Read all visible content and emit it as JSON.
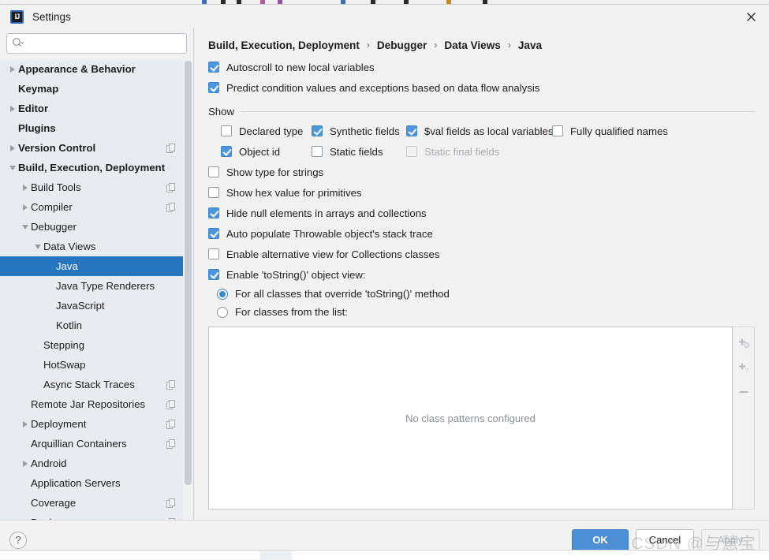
{
  "window": {
    "title": "Settings",
    "logo_text": "IJ",
    "close_icon": "close-icon"
  },
  "search": {
    "value": "",
    "placeholder": "",
    "icon": "search-dropdown-icon"
  },
  "sidebar": {
    "items": [
      {
        "label": "Appearance & Behavior",
        "indent": 0,
        "arrow": "right",
        "bold": true,
        "selected": false,
        "copy": false
      },
      {
        "label": "Keymap",
        "indent": 0,
        "arrow": "none",
        "bold": true,
        "selected": false,
        "copy": false
      },
      {
        "label": "Editor",
        "indent": 0,
        "arrow": "right",
        "bold": true,
        "selected": false,
        "copy": false
      },
      {
        "label": "Plugins",
        "indent": 0,
        "arrow": "none",
        "bold": true,
        "selected": false,
        "copy": false
      },
      {
        "label": "Version Control",
        "indent": 0,
        "arrow": "right",
        "bold": true,
        "selected": false,
        "copy": true
      },
      {
        "label": "Build, Execution, Deployment",
        "indent": 0,
        "arrow": "down",
        "bold": true,
        "selected": false,
        "copy": false
      },
      {
        "label": "Build Tools",
        "indent": 1,
        "arrow": "right",
        "bold": false,
        "selected": false,
        "copy": true
      },
      {
        "label": "Compiler",
        "indent": 1,
        "arrow": "right",
        "bold": false,
        "selected": false,
        "copy": true
      },
      {
        "label": "Debugger",
        "indent": 1,
        "arrow": "down",
        "bold": false,
        "selected": false,
        "copy": false
      },
      {
        "label": "Data Views",
        "indent": 2,
        "arrow": "down",
        "bold": false,
        "selected": false,
        "copy": false
      },
      {
        "label": "Java",
        "indent": 3,
        "arrow": "none",
        "bold": false,
        "selected": true,
        "copy": false
      },
      {
        "label": "Java Type Renderers",
        "indent": 3,
        "arrow": "none",
        "bold": false,
        "selected": false,
        "copy": false
      },
      {
        "label": "JavaScript",
        "indent": 3,
        "arrow": "none",
        "bold": false,
        "selected": false,
        "copy": false
      },
      {
        "label": "Kotlin",
        "indent": 3,
        "arrow": "none",
        "bold": false,
        "selected": false,
        "copy": false
      },
      {
        "label": "Stepping",
        "indent": 2,
        "arrow": "none",
        "bold": false,
        "selected": false,
        "copy": false
      },
      {
        "label": "HotSwap",
        "indent": 2,
        "arrow": "none",
        "bold": false,
        "selected": false,
        "copy": false
      },
      {
        "label": "Async Stack Traces",
        "indent": 2,
        "arrow": "none",
        "bold": false,
        "selected": false,
        "copy": true
      },
      {
        "label": "Remote Jar Repositories",
        "indent": 1,
        "arrow": "none",
        "bold": false,
        "selected": false,
        "copy": true
      },
      {
        "label": "Deployment",
        "indent": 1,
        "arrow": "right",
        "bold": false,
        "selected": false,
        "copy": true
      },
      {
        "label": "Arquillian Containers",
        "indent": 1,
        "arrow": "none",
        "bold": false,
        "selected": false,
        "copy": true
      },
      {
        "label": "Android",
        "indent": 1,
        "arrow": "right",
        "bold": false,
        "selected": false,
        "copy": false
      },
      {
        "label": "Application Servers",
        "indent": 1,
        "arrow": "none",
        "bold": false,
        "selected": false,
        "copy": false
      },
      {
        "label": "Coverage",
        "indent": 1,
        "arrow": "none",
        "bold": false,
        "selected": false,
        "copy": true
      },
      {
        "label": "Docker",
        "indent": 1,
        "arrow": "right",
        "bold": false,
        "selected": false,
        "copy": true
      }
    ]
  },
  "breadcrumb": {
    "parts": [
      "Build, Execution, Deployment",
      "Debugger",
      "Data Views",
      "Java"
    ],
    "separator": "›"
  },
  "main": {
    "top_options": [
      {
        "label": "Autoscroll to new local variables",
        "checked": true,
        "disabled": false
      },
      {
        "label": "Predict condition values and exceptions based on data flow analysis",
        "checked": true,
        "disabled": false
      }
    ],
    "show_group": {
      "title": "Show",
      "row1": [
        {
          "label": "Declared type",
          "checked": false,
          "disabled": false
        },
        {
          "label": "Synthetic fields",
          "checked": true,
          "disabled": false
        },
        {
          "label": "$val fields as local variables",
          "checked": true,
          "disabled": false
        },
        {
          "label": "Fully qualified names",
          "checked": false,
          "disabled": false
        }
      ],
      "row2": [
        {
          "label": "Object id",
          "checked": true,
          "disabled": false
        },
        {
          "label": "Static fields",
          "checked": false,
          "disabled": false
        },
        {
          "label": "Static final fields",
          "checked": false,
          "disabled": true
        }
      ]
    },
    "options": [
      {
        "label": "Show type for strings",
        "checked": false
      },
      {
        "label": "Show hex value for primitives",
        "checked": false
      },
      {
        "label": "Hide null elements in arrays and collections",
        "checked": true
      },
      {
        "label": "Auto populate Throwable object's stack trace",
        "checked": true
      },
      {
        "label": "Enable alternative view for Collections classes",
        "checked": false
      },
      {
        "label": "Enable 'toString()' object view:",
        "checked": true
      }
    ],
    "radios": [
      {
        "label": "For all classes that override 'toString()' method",
        "checked": true
      },
      {
        "label": "For classes from the list:",
        "checked": false
      }
    ],
    "list_panel": {
      "empty_text": "No class patterns configured",
      "buttons": [
        {
          "name": "add-class-button",
          "glyph": "+",
          "disabled": true
        },
        {
          "name": "add-pattern-button",
          "glyph": "+?",
          "disabled": true
        },
        {
          "name": "remove-button",
          "glyph": "−",
          "disabled": true
        }
      ]
    }
  },
  "footer": {
    "help_label": "?",
    "ok_label": "OK",
    "cancel_label": "Cancel",
    "apply_label": "Apply"
  },
  "watermark": {
    "text": "CSDN @与慧宝"
  },
  "colors": {
    "selection_blue": "#2675bf",
    "checkbox_blue": "#4d97e0",
    "primary_button": "#4b8fd4",
    "sidebar_bg": "#e8ecf0",
    "panel_bg": "#f2f2f2"
  }
}
